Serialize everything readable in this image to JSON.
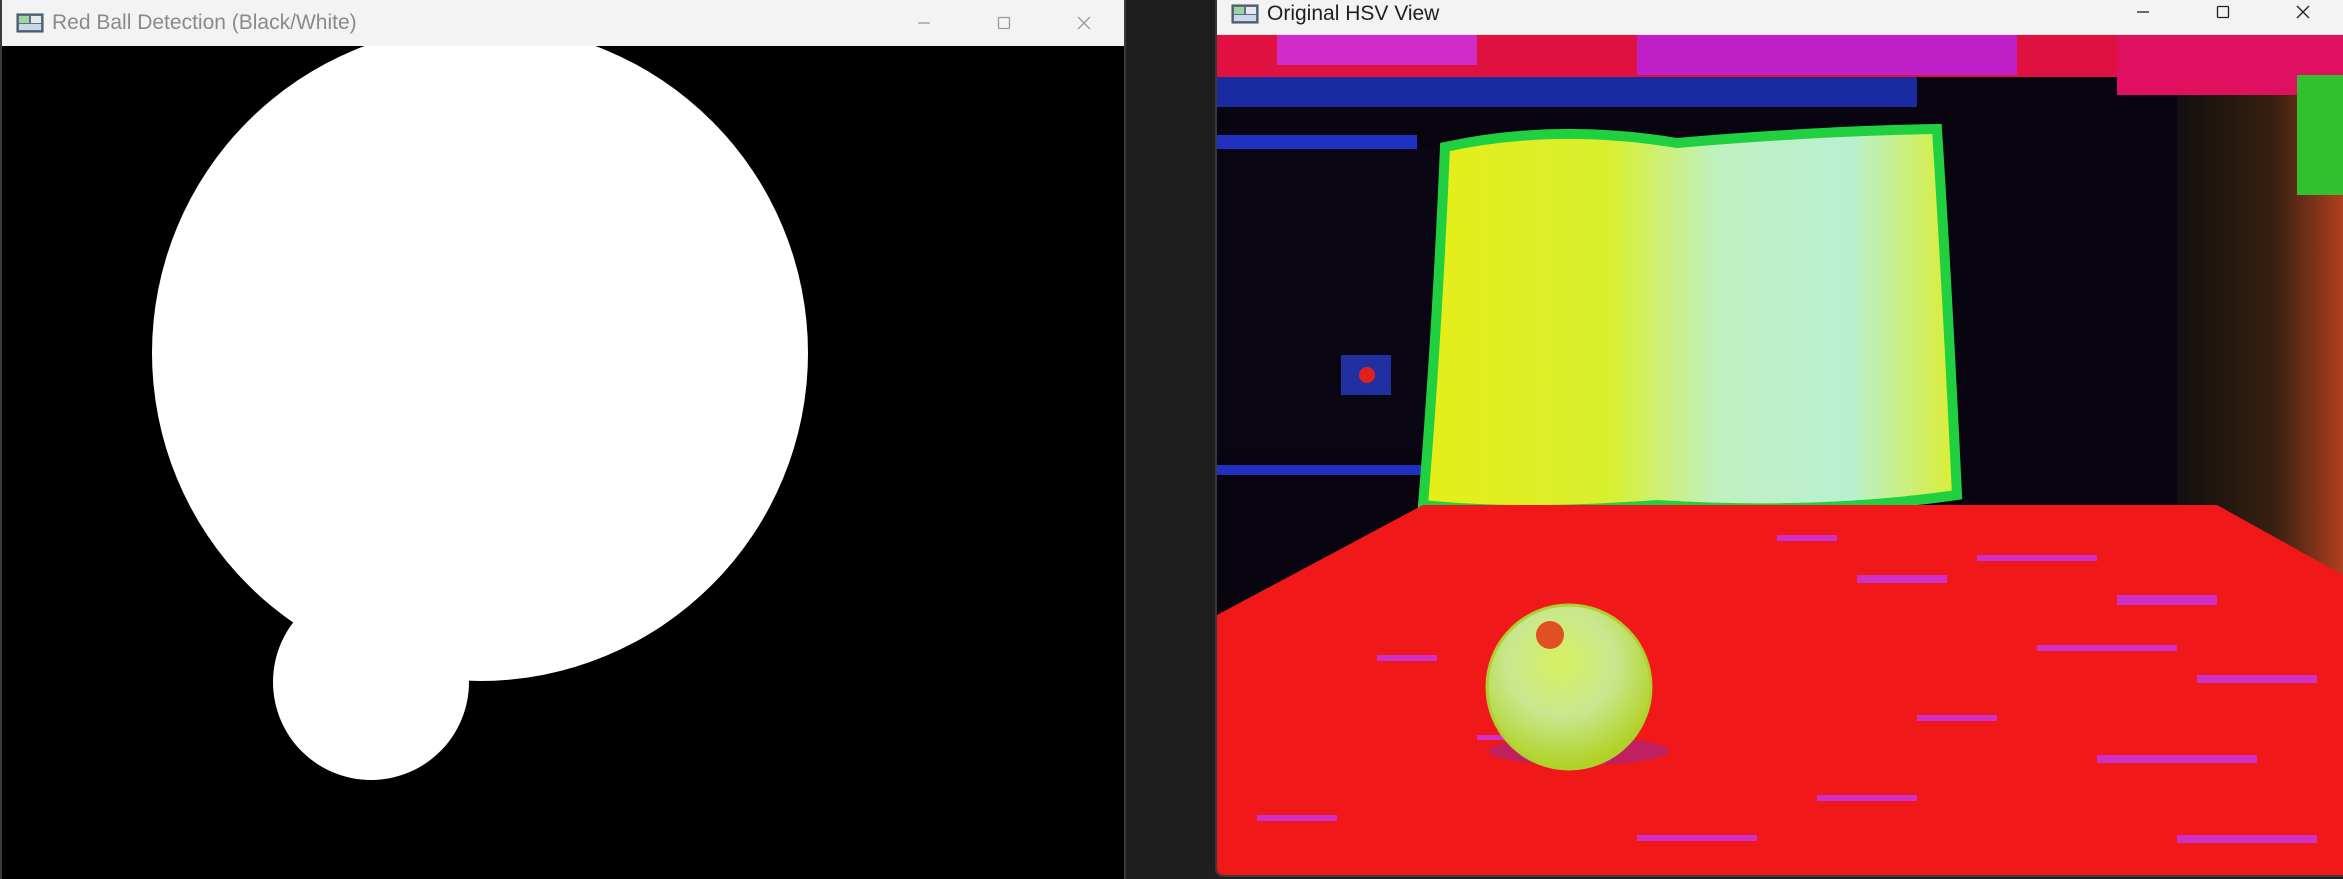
{
  "windows": {
    "detection": {
      "title": "Red Ball Detection (Black/White)",
      "controls": {
        "minimize": "minimize",
        "maximize": "maximize",
        "close": "close"
      }
    },
    "hsv": {
      "title": "Original HSV View",
      "controls": {
        "minimize": "minimize",
        "maximize": "maximize",
        "close": "close"
      }
    }
  },
  "colors": {
    "mask_white": "#ffffff",
    "mask_black": "#000000",
    "hsv_floor": "#f01818",
    "hsv_magenta": "#e030d0",
    "hsv_yellow": "#e8f020",
    "hsv_cyan_light": "#b8f0c8",
    "hsv_green": "#30e030",
    "hsv_blue": "#2030c0",
    "hsv_dark": "#080410"
  }
}
